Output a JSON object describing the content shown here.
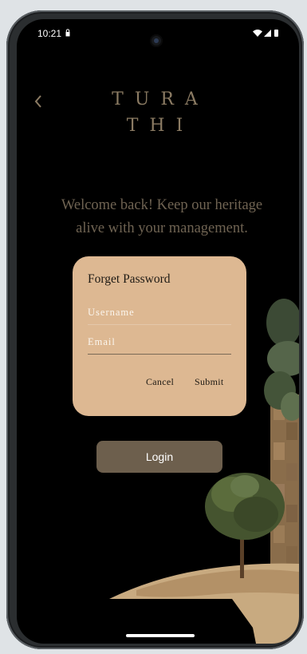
{
  "status_bar": {
    "time": "10:21"
  },
  "header": {
    "logo_line1": "TURA",
    "logo_line2": "THI",
    "back_icon": "chevron-left-icon"
  },
  "welcome": {
    "line1": "Welcome back! Keep our heritage",
    "line2": "alive with your management."
  },
  "login": {
    "label": "Login"
  },
  "dialog": {
    "title": "Forget Password",
    "username_placeholder": "Username",
    "email_placeholder": "Email",
    "cancel_label": "Cancel",
    "submit_label": "Submit"
  },
  "colors": {
    "background": "#000000",
    "accent_text": "#6f6352",
    "dialog_bg": "#ddb892",
    "login_button": "#6d5f4d"
  }
}
